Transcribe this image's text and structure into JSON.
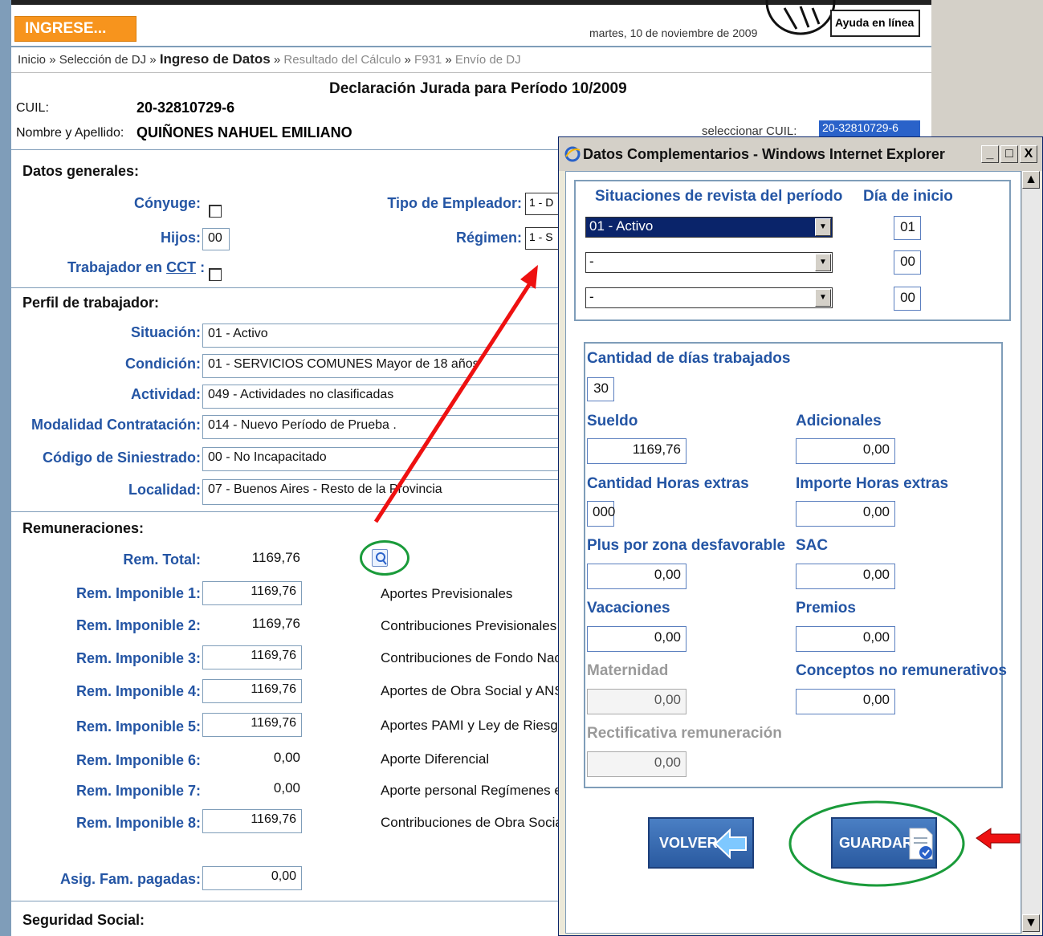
{
  "header": {
    "ingrese_label": "INGRESE...",
    "date": "martes, 10 de noviembre de 2009",
    "help_label": "Ayuda en línea"
  },
  "breadcrumb": {
    "inicio": "Inicio",
    "sel_dj": "Selección de DJ",
    "ingreso": "Ingreso de Datos",
    "resultado": "Resultado del Cálculo",
    "f931": "F931",
    "envio": "Envío de DJ",
    "sep": "»"
  },
  "page_title": "Declaración Jurada para Período 10/2009",
  "cuil": {
    "label": "CUIL:",
    "value": "20-32810729-6"
  },
  "nombre": {
    "label": "Nombre y Apellido:",
    "value": "QUIÑONES NAHUEL EMILIANO"
  },
  "selector": {
    "label": "seleccionar CUIL:",
    "value": "20-32810729-6"
  },
  "datos_generales": {
    "title": "Datos generales:",
    "conyuge_label": "Cónyuge:",
    "hijos_label": "Hijos:",
    "hijos_value": "00",
    "cct_label": "Trabajador en",
    "cct_link": "CCT",
    "cct_colon": ":",
    "tipo_empleador_label": "Tipo de Empleador:",
    "tipo_empleador_value": "1 - D",
    "regimen_label": "Régimen:",
    "regimen_value": "1 - S"
  },
  "perfil": {
    "title": "Perfil de trabajador:",
    "rows": [
      {
        "label": "Situación:",
        "value": "01 - Activo"
      },
      {
        "label": "Condición:",
        "value": "01 - SERVICIOS COMUNES Mayor de 18 años"
      },
      {
        "label": "Actividad:",
        "value": "049 - Actividades no clasificadas"
      },
      {
        "label": "Modalidad Contratación:",
        "value": "014 - Nuevo Período de Prueba ."
      },
      {
        "label": "Código de Siniestrado:",
        "value": "00 - No Incapacitado"
      },
      {
        "label": "Localidad:",
        "value": "07 - Buenos Aires - Resto de la Provincia"
      }
    ]
  },
  "remuneraciones": {
    "title": "Remuneraciones:",
    "rows": [
      {
        "label": "Rem. Total:",
        "value": "1169,76",
        "right": ""
      },
      {
        "label": "Rem. Imponible 1:",
        "value": "1169,76",
        "right": "Aportes Previsionales"
      },
      {
        "label": "Rem. Imponible 2:",
        "value": "1169,76",
        "right": "Contribuciones Previsionales y"
      },
      {
        "label": "Rem. Imponible 3:",
        "value": "1169,76",
        "right": "Contribuciones de Fondo Nacio"
      },
      {
        "label": "Rem. Imponible 4:",
        "value": "1169,76",
        "right": "Aportes de Obra Social y ANSS"
      },
      {
        "label": "Rem. Imponible 5:",
        "value": "1169,76",
        "right": "Aportes PAMI y Ley de Riesgos"
      },
      {
        "label": "Rem. Imponible 6:",
        "value": "0,00",
        "right": "Aporte Diferencial"
      },
      {
        "label": "Rem. Imponible 7:",
        "value": "0,00",
        "right": "Aporte personal Regímenes esp"
      },
      {
        "label": "Rem. Imponible 8:",
        "value": "1169,76",
        "right": "Contribuciones de Obra Social"
      }
    ],
    "asig_label": "Asig. Fam. pagadas:",
    "asig_value": "0,00"
  },
  "seguridad_social_title": "Seguridad Social:",
  "popup": {
    "title": "Datos Complementarios - Windows Internet Explorer",
    "situaciones_header": "Situaciones de revista del período",
    "dia_header": "Día de inicio",
    "situaciones": [
      {
        "value": "01 - Activo",
        "day": "01"
      },
      {
        "value": "-",
        "day": "00"
      },
      {
        "value": "-",
        "day": "00"
      }
    ],
    "dias_label": "Cantidad de días trabajados",
    "dias_value": "30",
    "sueldo_label": "Sueldo",
    "sueldo_value": "1169,76",
    "adicionales_label": "Adicionales",
    "adicionales_value": "0,00",
    "horas_label": "Cantidad Horas extras",
    "horas_value": "000",
    "importe_horas_label": "Importe Horas extras",
    "importe_horas_value": "0,00",
    "plus_label": "Plus por zona desfavorable",
    "plus_value": "0,00",
    "sac_label": "SAC",
    "sac_value": "0,00",
    "vacaciones_label": "Vacaciones",
    "vacaciones_value": "0,00",
    "premios_label": "Premios",
    "premios_value": "0,00",
    "maternidad_label": "Maternidad",
    "maternidad_value": "0,00",
    "conceptos_label": "Conceptos no remunerativos",
    "conceptos_value": "0,00",
    "rectificativa_label": "Rectificativa  remuneración",
    "rectificativa_value": "0,00",
    "volver_label": "VOLVER",
    "guardar_label": "GUARDAR"
  },
  "colors": {
    "label_blue": "#2455a4",
    "orange": "#f7941d",
    "annotation_red": "#ee1111",
    "annotation_green": "#1a9b3a"
  }
}
